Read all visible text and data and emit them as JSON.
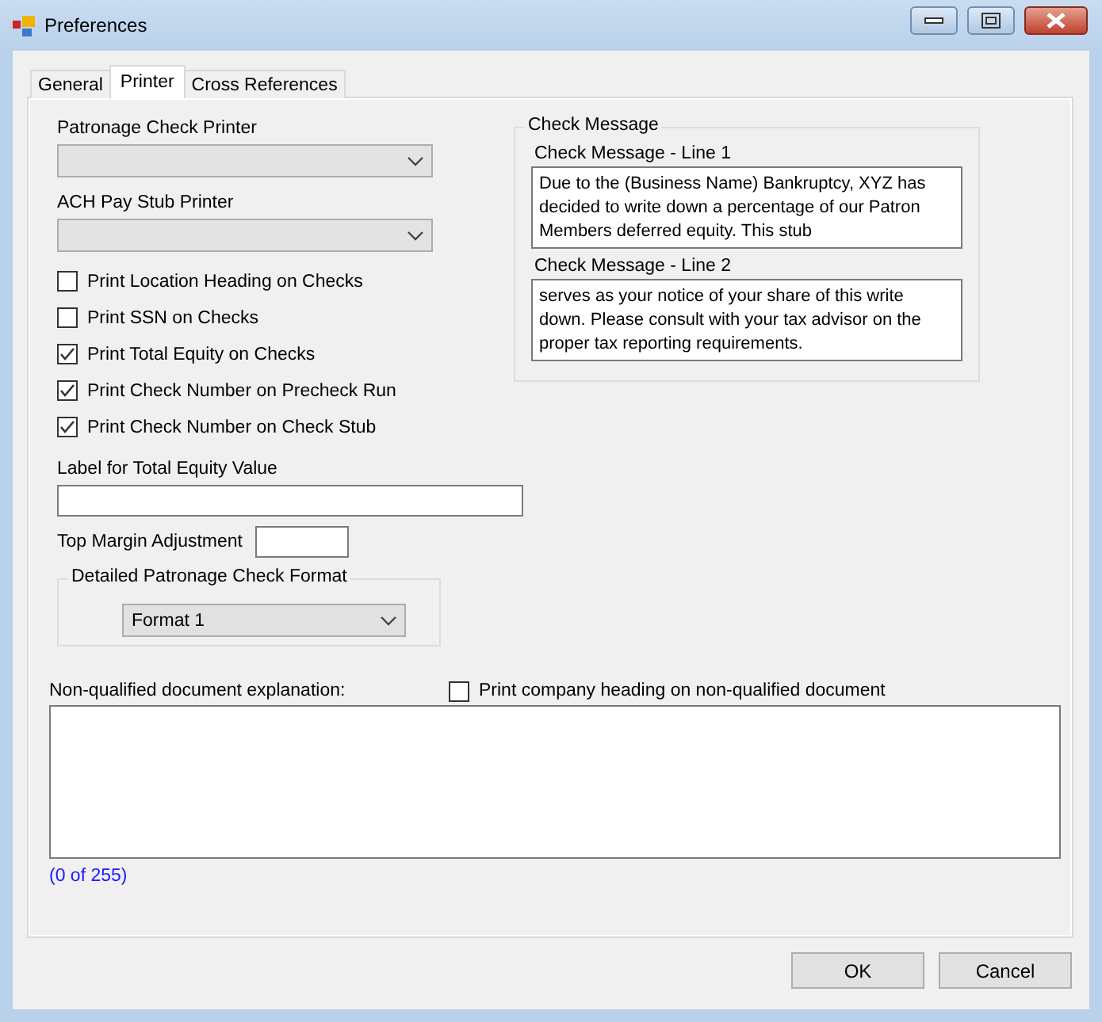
{
  "window": {
    "title": "Preferences"
  },
  "tabs": [
    {
      "label": "General",
      "selected": false
    },
    {
      "label": "Printer",
      "selected": true
    },
    {
      "label": "Cross References",
      "selected": false
    }
  ],
  "printers": [
    {
      "label": "Patronage Check Printer",
      "disabled": true
    },
    {
      "label": "ACH Pay Stub Printer",
      "disabled": true
    }
  ],
  "options": [
    {
      "label": "Print Location Heading on Checks",
      "checked": false
    },
    {
      "label": "Print SSN on Checks",
      "checked": false
    },
    {
      "label": "Print Total Equity on Checks",
      "checked": true
    },
    {
      "label": "Print Check Number on Precheck Run",
      "checked": true
    },
    {
      "label": "Print Check Number on Check Stub",
      "checked": true
    }
  ],
  "total_equity_label": {
    "label": "Label for Total Equity Value"
  },
  "top_margin": {
    "label": "Top Margin Adjustment"
  },
  "check_format": {
    "group": "Detailed Patronage Check Format",
    "value": "Format 1"
  },
  "check_message": {
    "group": "Check Message",
    "lines": [
      {
        "label": "Check Message - Line 1",
        "value": "Due to the (Business Name) Bankruptcy, XYZ has decided to write down a percentage of our Patron Members deferred equity. This stub"
      },
      {
        "label": "Check Message - Line 2",
        "value": "serves as your notice of your share of this write down. Please consult with your tax advisor on the proper tax reporting requirements."
      }
    ]
  },
  "explanation": {
    "label": "Non-qualified document explanation:",
    "counter": "(0 of 255)"
  },
  "company_heading": {
    "label": "Print company heading on non-qualified document",
    "checked": false
  },
  "buttons": [
    "OK",
    "Cancel"
  ]
}
